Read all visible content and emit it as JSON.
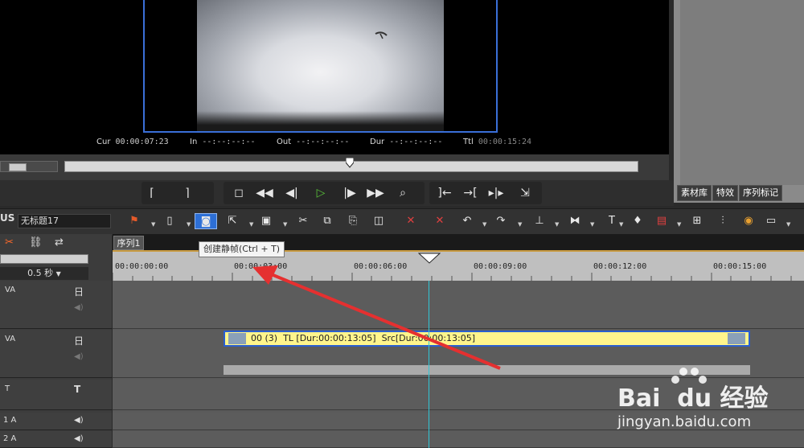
{
  "preview": {
    "cur_label": "Cur",
    "cur_value": "00:00:07:23",
    "in_label": "In",
    "in_value": "--:--:--:--",
    "out_label": "Out",
    "out_value": "--:--:--:--",
    "dur_label": "Dur",
    "dur_value": "--:--:--:--",
    "ttl_label": "Ttl",
    "ttl_value": "00:00:15:24"
  },
  "right_panel": {
    "tabs": [
      "素材库",
      "特效",
      "序列标记"
    ]
  },
  "project": {
    "label": "US",
    "name": "无标题17"
  },
  "tooltip": "创建静帧(Ctrl + T)",
  "timeline": {
    "sequence_tab": "序列1",
    "scale": "0.5 秒",
    "ruler_ticks": [
      "00:00:00:00",
      "00:00:03:00",
      "00:00:06:00",
      "00:00:09:00",
      "00:00:12:00",
      "00:00:15:00"
    ],
    "tracks": [
      {
        "name": "VA",
        "lock": "日"
      },
      {
        "name": "VA",
        "lock": "日"
      },
      {
        "name": "T",
        "lock": "T"
      },
      {
        "name": "1 A",
        "lock": "◀)"
      },
      {
        "name": "2 A",
        "lock": "◀)"
      }
    ],
    "clip": {
      "label": "00 (3)  TL [Dur:00:00:13:05]  Src[Dur:00:00:13:05]"
    }
  },
  "watermark": {
    "brand": "Bai  du 经验",
    "url": "jingyan.baidu.com"
  },
  "colors": {
    "accent_blue": "#3a6fd8",
    "clip_yellow": "#fff58c",
    "playhead_cyan": "#2fc6d6",
    "play_green": "#59c23a",
    "arrow_red": "#e53030"
  }
}
